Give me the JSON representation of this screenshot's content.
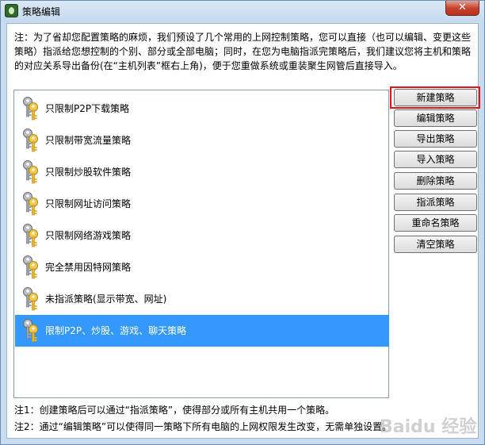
{
  "window": {
    "title": "策略编辑",
    "close_label": "✕"
  },
  "notice": "注：为了省却您配置策略的麻烦，我们预设了几个常用的上网控制策略，您可以直接（也可以编辑、变更这些策略）指派给您想控制的个别、部分或全部电脑；同时，在您为电脑指派完策略后，我们建议您将主机和策略的对应关系导出备份(在“主机列表”框右上角)，便于您重做系统或重装聚生网管后直接导入。",
  "policies": [
    {
      "label": "只限制P2P下载策略",
      "selected": false
    },
    {
      "label": "只限制带宽流量策略",
      "selected": false
    },
    {
      "label": "只限制炒股软件策略",
      "selected": false
    },
    {
      "label": "只限制网址访问策略",
      "selected": false
    },
    {
      "label": "只限制网络游戏策略",
      "selected": false
    },
    {
      "label": "完全禁用因特网策略",
      "selected": false
    },
    {
      "label": "未指派策略(显示带宽、网址)",
      "selected": false
    },
    {
      "label": "限制P2P、炒股、游戏、聊天策略",
      "selected": true
    }
  ],
  "buttons": {
    "new": "新建策略",
    "edit": "编辑策略",
    "export": "导出策略",
    "import": "导入策略",
    "delete": "删除策略",
    "assign": "指派策略",
    "rename": "重命名策略",
    "clear": "清空策略"
  },
  "footnotes": {
    "note1": "注1：创建策略后可以通过“指派策略”，使得部分或所有主机共用一个策略。",
    "note2": "注2：通过“编辑策略”可以使得同一策略下所有电脑的上网权限发生改变，无需单独设置。"
  },
  "watermark": "Baidu 经验",
  "colors": {
    "selection": "#3399ff",
    "highlight_border": "#e3131c"
  }
}
